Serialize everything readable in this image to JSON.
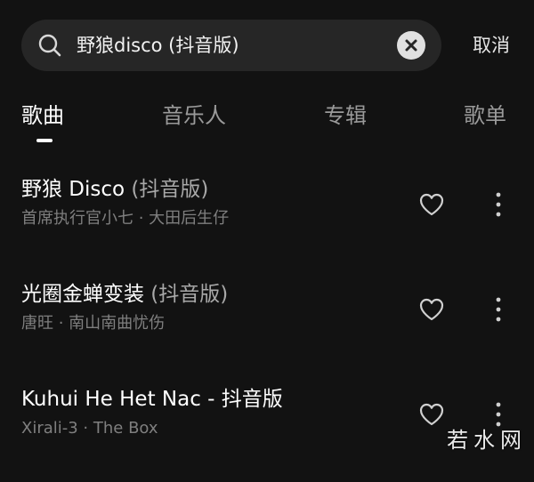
{
  "search": {
    "query": "野狼disco (抖音版)",
    "cancel_label": "取消"
  },
  "tabs": [
    {
      "label": "歌曲",
      "active": true
    },
    {
      "label": "音乐人",
      "active": false
    },
    {
      "label": "专辑",
      "active": false
    },
    {
      "label": "歌单",
      "active": false
    }
  ],
  "songs": [
    {
      "title": "野狼 Disco",
      "suffix": " (抖音版)",
      "artists": "首席执行官小七 · 大田后生仔"
    },
    {
      "title": "光圈金蝉变装",
      "suffix": " (抖音版)",
      "artists": "唐旺 · 南山南曲忧伤"
    },
    {
      "title": "Kuhui He Het Nac - 抖音版",
      "suffix": "",
      "artists": "Xirali-3 · The Box"
    }
  ],
  "watermark": {
    "text": "若水网"
  },
  "colors": {
    "background": "#121212",
    "search_bg": "#262626",
    "primary_text": "#ffffff",
    "secondary_text": "#7f7f7f",
    "inactive_tab": "#9a9a9a"
  },
  "icons": {
    "search": "search-icon",
    "clear": "clear-icon",
    "like": "heart-icon",
    "more": "more-vertical-icon"
  }
}
